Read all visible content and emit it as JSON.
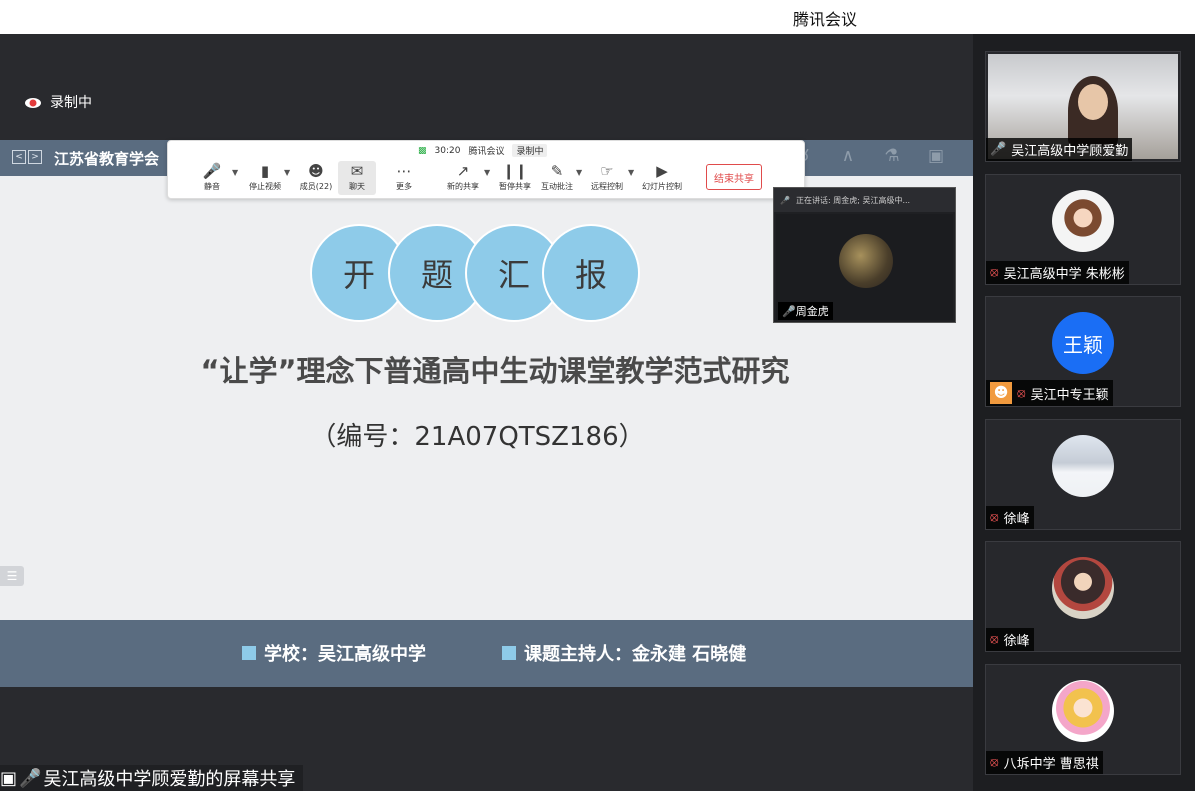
{
  "window": {
    "title": "腾讯会议"
  },
  "recording": {
    "label": "录制中"
  },
  "slide": {
    "org": "江苏省教育学会",
    "circles": [
      "开",
      "题",
      "汇",
      "报"
    ],
    "title": "“让学”理念下普通高中生动课堂教学范式研究",
    "code": "（编号：21A07QTSZ186）",
    "footer": {
      "school": "学校：吴江高级中学",
      "host": "课题主持人：金永建  石晓健"
    }
  },
  "toolbar": {
    "time": "30:20",
    "app": "腾讯会议",
    "recording": "录制中",
    "buttons": [
      {
        "label": "静音",
        "icon": "mic-icon"
      },
      {
        "label": "停止视频",
        "icon": "camera-icon"
      },
      {
        "label": "成员(22)",
        "icon": "members-icon"
      },
      {
        "label": "聊天",
        "icon": "chat-icon"
      },
      {
        "label": "更多",
        "icon": "more-icon"
      },
      {
        "label": "新的共享",
        "icon": "new-share-icon"
      },
      {
        "label": "暂停共享",
        "icon": "pause-share-icon"
      },
      {
        "label": "互动批注",
        "icon": "annotate-icon"
      },
      {
        "label": "远程控制",
        "icon": "remote-control-icon"
      },
      {
        "label": "幻灯片控制",
        "icon": "slide-control-icon"
      }
    ],
    "end_share": "结束共享"
  },
  "speaker": {
    "status": "正在讲话: 周金虎; 吴江高级中...",
    "name": "周金虎"
  },
  "share_label": "吴江高级中学顾爱勤的屏幕共享",
  "participants": [
    {
      "name": "吴江高级中学顾爱勤",
      "muted": false
    },
    {
      "name": "吴江高级中学 朱彬彬",
      "muted": true
    },
    {
      "name": "吴江中专王颖",
      "muted": true,
      "avatar_text": "王颖"
    },
    {
      "name": "徐峰",
      "muted": true
    },
    {
      "name": "徐峰",
      "muted": true
    },
    {
      "name": "八坼中学 曹思祺",
      "muted": true
    }
  ],
  "colors": {
    "slide_band": "#5a6c80",
    "circle": "#8ecbe9",
    "end_share": "#e04b4b",
    "avatar_blue": "#1a6ef5"
  }
}
